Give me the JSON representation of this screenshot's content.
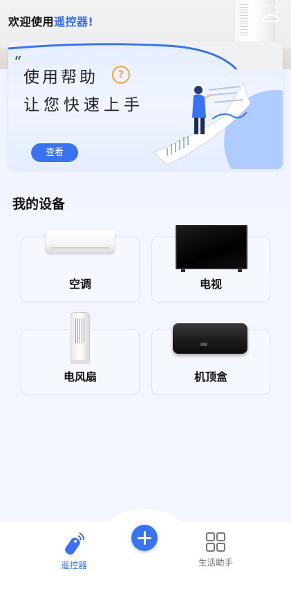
{
  "header": {
    "greeting_prefix": "欢迎使用",
    "greeting_app": "遥控器",
    "greeting_suffix": "!",
    "profile_icon": "user-icon"
  },
  "banner": {
    "quote_mark": "“",
    "title_line1": "使用帮助",
    "title_line2": "让您快速上手",
    "help_icon_glyph": "?",
    "button_label": "查看",
    "accent_color": "#3a73f0"
  },
  "devices": {
    "section_title": "我的设备",
    "items": [
      {
        "label": "空调",
        "icon": "air-conditioner-image"
      },
      {
        "label": "电视",
        "icon": "television-image"
      },
      {
        "label": "电风扇",
        "icon": "electric-fan-image"
      },
      {
        "label": "机顶盒",
        "icon": "set-top-box-image"
      }
    ]
  },
  "bottom_nav": {
    "items": [
      {
        "label": "遥控器",
        "icon": "remote-control-icon",
        "active": true
      },
      {
        "label": "",
        "icon": "plus-icon",
        "active": false
      },
      {
        "label": "生活助手",
        "icon": "grid-icon",
        "active": false
      }
    ],
    "active_color": "#3a73f0",
    "inactive_color": "#666666"
  }
}
